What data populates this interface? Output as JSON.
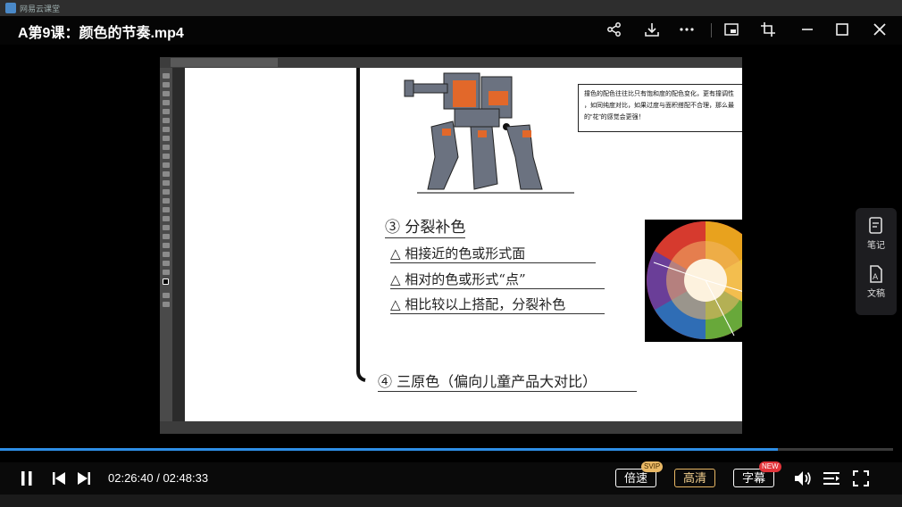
{
  "window": {
    "app_name": "网易云课堂",
    "title": "A第9课：颜色的节奏.mp4"
  },
  "titlebar_icons": [
    "share-icon",
    "download-icon",
    "more-icon",
    "pip-icon",
    "crop-icon",
    "minimize-icon",
    "maximize-icon",
    "close-icon"
  ],
  "slide": {
    "callout_lines": [
      "撞色的配色往往比只有饱和度的配色变化，更有撞调性",
      "，如同纯度对比，如果过度与面积搭配不合理，那么最",
      "的“花”的感觉会更强！"
    ],
    "heading": "③ 分裂补色",
    "bullets": [
      "△ 相接近的色或形式面",
      "△ 相对的色或形式“点”",
      "△ 相比较以上搭配，分裂补色"
    ],
    "footer_line": "④ 三原色（偏向儿童产品大对比）"
  },
  "side_panel": {
    "notes_label": "笔记",
    "transcript_label": "文稿"
  },
  "player": {
    "current_time": "02:26:40",
    "total_time": "02:48:33",
    "time_separator": " / ",
    "progress": 0.871,
    "speed_label": "倍速",
    "speed_badge": "SVIP",
    "quality_label": "高清",
    "subtitle_label": "字幕",
    "subtitle_badge": "NEW"
  },
  "colors": {
    "accent": "#2d8ee5",
    "gold": "#e9b865",
    "robot_orange": "#e2682a",
    "robot_gray": "#6b7280"
  }
}
